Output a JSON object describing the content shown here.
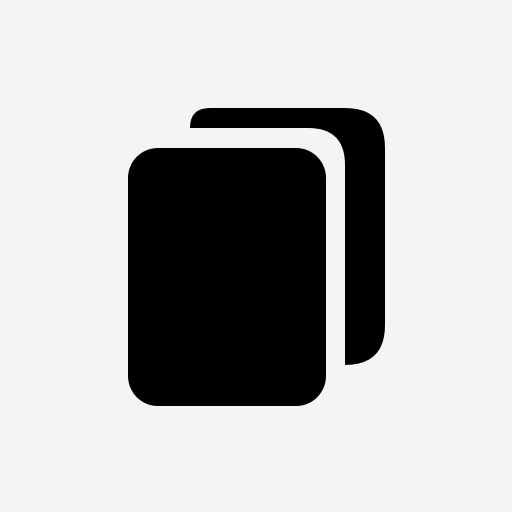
{
  "canvas": {
    "background_color": "#f4f4f4"
  },
  "icon": {
    "name": "copy-icon",
    "fill_color": "#000000",
    "layers": [
      "back-page",
      "front-page"
    ]
  }
}
